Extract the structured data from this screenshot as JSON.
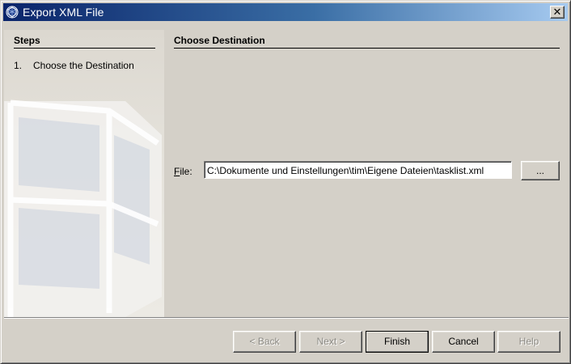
{
  "window": {
    "title": "Export XML File",
    "title_icon": "app-shield-icon",
    "close_glyph": "✕"
  },
  "steps": {
    "title": "Steps",
    "items": [
      {
        "number": "1.",
        "label": "Choose the Destination"
      }
    ]
  },
  "main": {
    "title": "Choose Destination",
    "file_label_mnemonic": "F",
    "file_label_rest": "ile:",
    "file_value": "C:\\Dokumente und Einstellungen\\tim\\Eigene Dateien\\tasklist.xml",
    "browse_label": "..."
  },
  "buttons": {
    "back": "< Back",
    "next": "Next >",
    "finish": "Finish",
    "cancel": "Cancel",
    "help": "Help"
  }
}
